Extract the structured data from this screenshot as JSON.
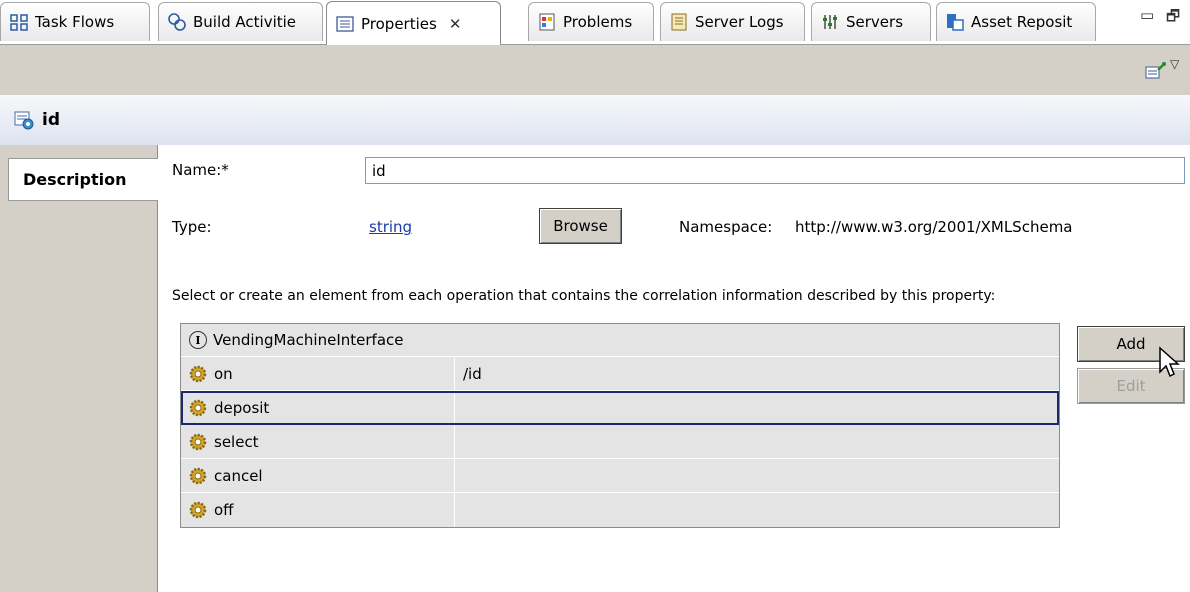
{
  "tabs": [
    {
      "label": "Task Flows",
      "icon": "task-flows-icon"
    },
    {
      "label": "Build Activitie",
      "icon": "build-activities-icon"
    },
    {
      "label": "Properties",
      "icon": "properties-icon",
      "active": true,
      "close": "✕"
    },
    {
      "label": "Problems",
      "icon": "problems-icon"
    },
    {
      "label": "Server Logs",
      "icon": "server-logs-icon"
    },
    {
      "label": "Servers",
      "icon": "servers-icon"
    },
    {
      "label": "Asset Reposit",
      "icon": "asset-repository-icon"
    }
  ],
  "window_controls": {
    "minimize": "▭",
    "maximize": "🗗"
  },
  "view_toolbar": {
    "menu_glyph": "▽"
  },
  "header": {
    "title": "id"
  },
  "left_tabs": [
    {
      "label": "Description"
    }
  ],
  "form": {
    "name_label": "Name:*",
    "name_value": "id",
    "type_label": "Type:",
    "type_value": "string",
    "browse_label": "Browse",
    "namespace_label": "Namespace:",
    "namespace_value": "http://www.w3.org/2001/XMLSchema",
    "instruction": "Select or create an element from each operation that contains the correlation information described by this property:"
  },
  "table": {
    "interface": "VendingMachineInterface",
    "interface_badge": "I",
    "rows": [
      {
        "operation": "on",
        "value": "/id"
      },
      {
        "operation": "deposit",
        "value": "",
        "selected": true
      },
      {
        "operation": "select",
        "value": ""
      },
      {
        "operation": "cancel",
        "value": ""
      },
      {
        "operation": "off",
        "value": ""
      }
    ]
  },
  "buttons": {
    "add": "Add",
    "edit": "Edit"
  },
  "colors": {
    "link": "#1a3ba8",
    "panel": "#d4d0c8",
    "selection_border": "#1b2a6b"
  }
}
